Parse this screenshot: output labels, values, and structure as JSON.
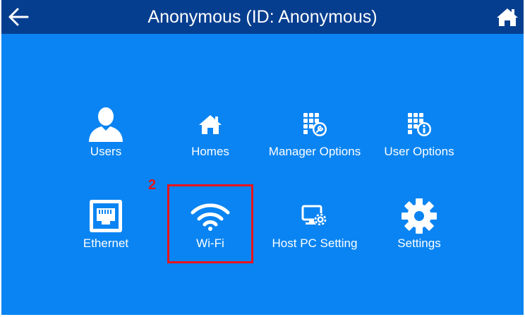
{
  "header": {
    "title": "Anonymous (ID: Anonymous)",
    "back_icon": "arrow-left-icon",
    "home_icon": "home-icon"
  },
  "menu": {
    "items": [
      {
        "label": "Users",
        "icon": "user-icon"
      },
      {
        "label": "Homes",
        "icon": "home-icon"
      },
      {
        "label": "Manager Options",
        "icon": "keypad-wrench-icon"
      },
      {
        "label": "User Options",
        "icon": "keypad-info-icon"
      },
      {
        "label": "Ethernet",
        "icon": "ethernet-port-icon"
      },
      {
        "label": "Wi-Fi",
        "icon": "wifi-icon"
      },
      {
        "label": "Host PC Setting",
        "icon": "monitor-gear-icon"
      },
      {
        "label": "Settings",
        "icon": "gear-icon"
      }
    ]
  },
  "annotation": {
    "step_number": "2",
    "highlight_color": "#e8141a",
    "highlighted_item": "Wi-Fi"
  },
  "colors": {
    "background": "#0a84f2",
    "header_bar": "#063e8f",
    "text": "#ffffff"
  }
}
